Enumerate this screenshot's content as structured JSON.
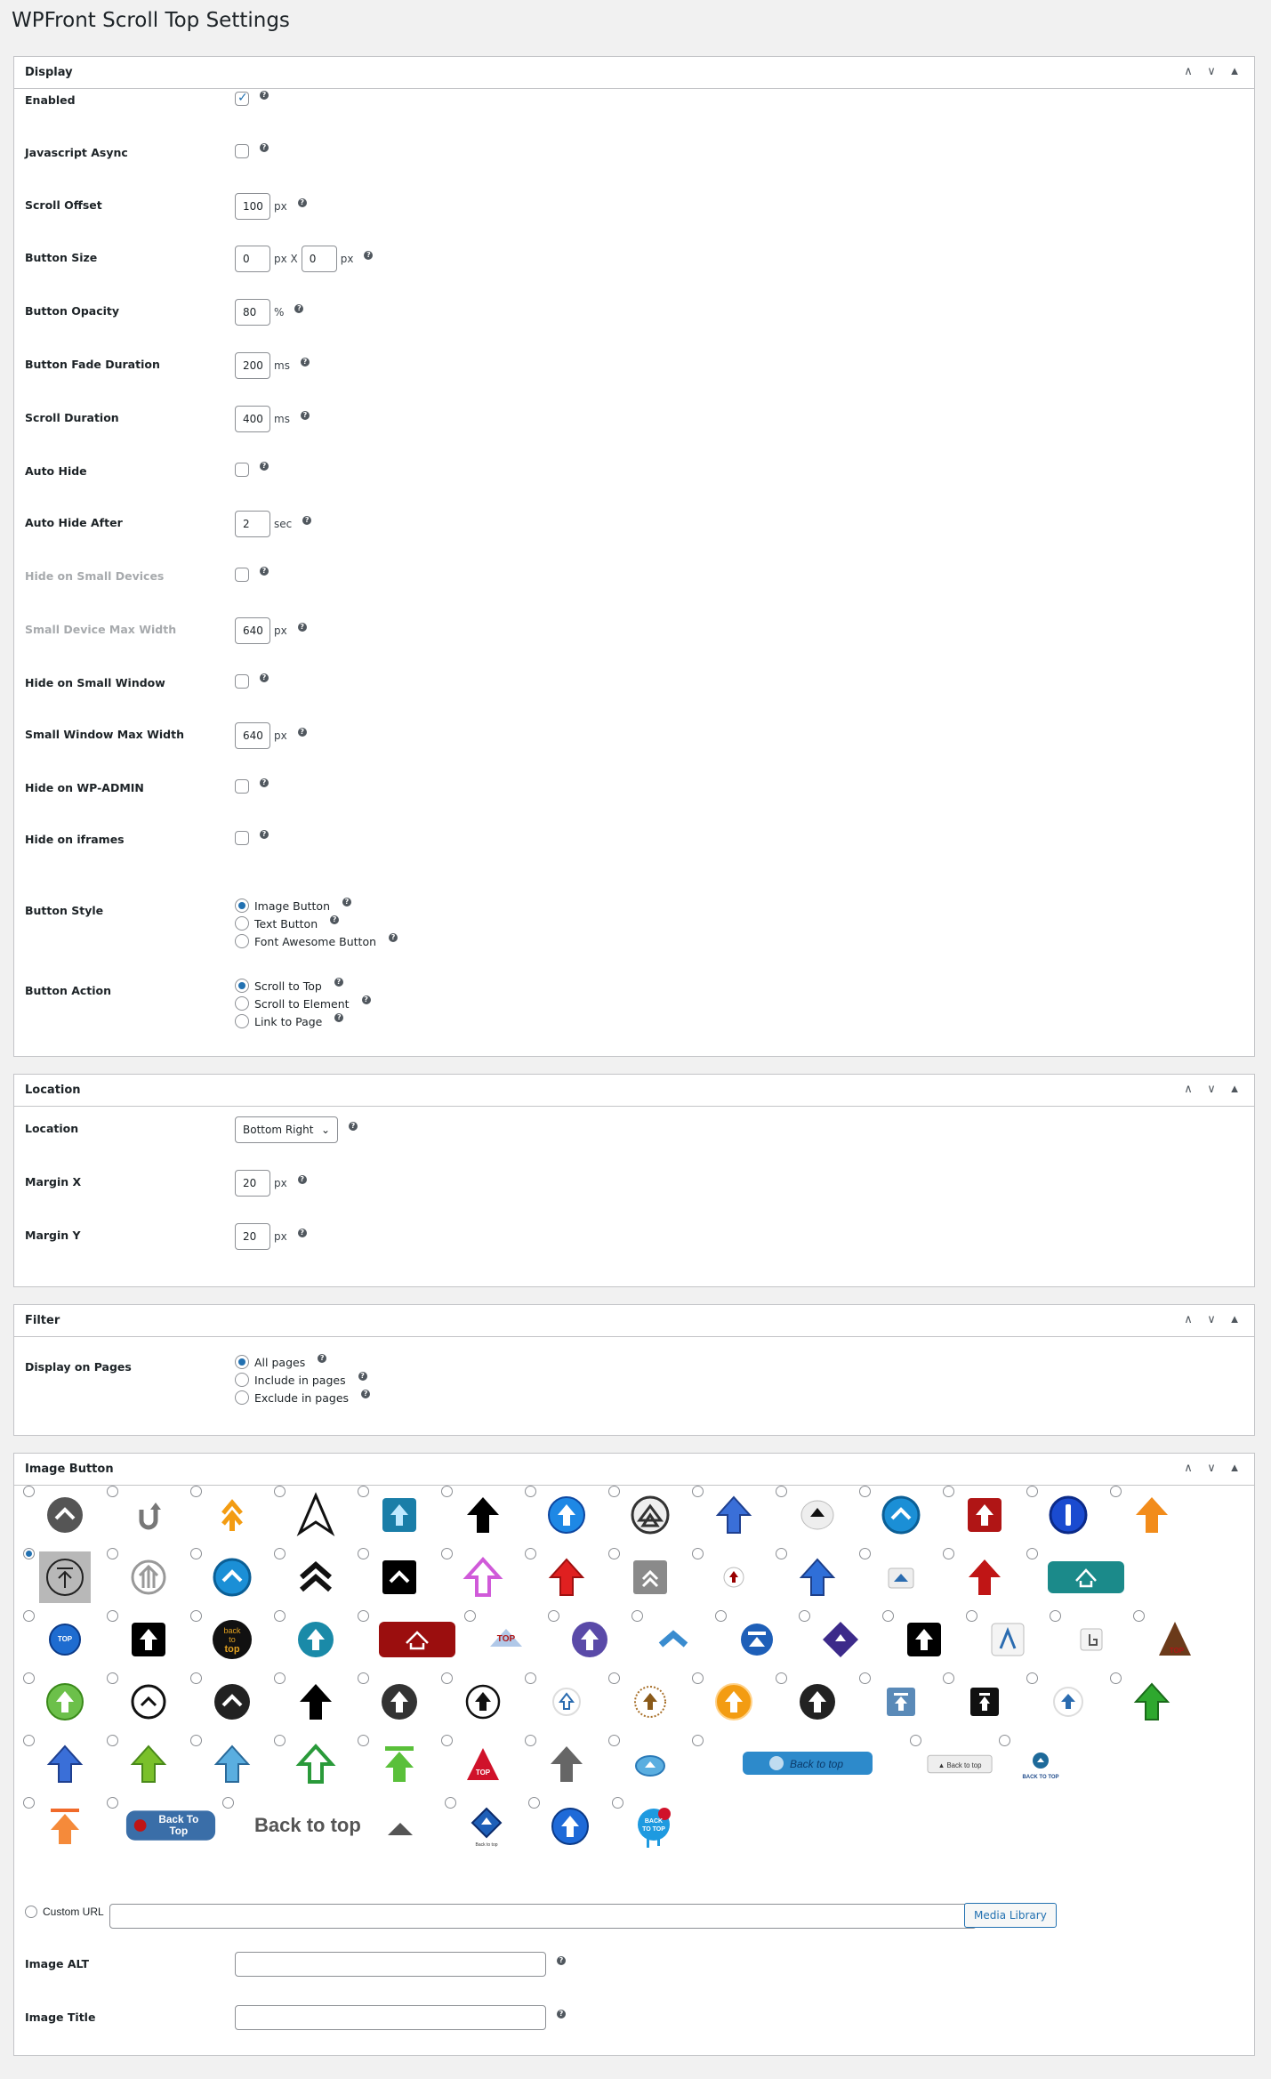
{
  "page_title": "WPFront Scroll Top Settings",
  "panel_controls": {
    "up": "∧",
    "down": "∨",
    "toggle": "▲"
  },
  "display": {
    "title": "Display",
    "rows": [
      {
        "label": "Enabled",
        "type": "checkbox",
        "checked": true
      },
      {
        "label": "Javascript Async",
        "type": "checkbox",
        "checked": false
      },
      {
        "label": "Scroll Offset",
        "type": "number",
        "value": "100",
        "unit": "px"
      },
      {
        "label": "Button Size",
        "type": "size",
        "value": "0",
        "unit": "px X",
        "value2": "0",
        "unit2": "px"
      },
      {
        "label": "Button Opacity",
        "type": "number",
        "value": "80",
        "unit": "%"
      },
      {
        "label": "Button Fade Duration",
        "type": "number",
        "value": "200",
        "unit": "ms"
      },
      {
        "label": "Scroll Duration",
        "type": "number",
        "value": "400",
        "unit": "ms"
      },
      {
        "label": "Auto Hide",
        "type": "checkbox",
        "checked": false
      },
      {
        "label": "Auto Hide After",
        "type": "number",
        "value": "2",
        "unit": "sec"
      },
      {
        "label": "Hide on Small Devices",
        "type": "checkbox",
        "checked": false,
        "dim": true
      },
      {
        "label": "Small Device Max Width",
        "type": "number",
        "value": "640",
        "unit": "px",
        "dim": true
      },
      {
        "label": "Hide on Small Window",
        "type": "checkbox",
        "checked": false
      },
      {
        "label": "Small Window Max Width",
        "type": "number",
        "value": "640",
        "unit": "px"
      },
      {
        "label": "Hide on WP-ADMIN",
        "type": "checkbox",
        "checked": false
      },
      {
        "label": "Hide on iframes",
        "type": "checkbox",
        "checked": false
      }
    ],
    "button_style": {
      "label": "Button Style",
      "options": [
        "Image Button",
        "Text Button",
        "Font Awesome Button"
      ],
      "selected": 0
    },
    "button_action": {
      "label": "Button Action",
      "options": [
        "Scroll to Top",
        "Scroll to Element",
        "Link to Page"
      ],
      "selected": 0
    }
  },
  "location": {
    "title": "Location",
    "location_label": "Location",
    "location_value": "Bottom Right",
    "margin_x_label": "Margin X",
    "margin_x": "20",
    "margin_y_label": "Margin Y",
    "margin_y": "20",
    "unit": "px"
  },
  "filter": {
    "title": "Filter",
    "label": "Display on Pages",
    "options": [
      "All pages",
      "Include in pages",
      "Exclude in pages"
    ],
    "selected": 0
  },
  "image_button": {
    "title": "Image Button",
    "selected_index": 14,
    "icons": [
      "gray-circle-chevron",
      "u-turn-arrow",
      "orange-double-chevron",
      "black-outline-arrow",
      "teal-square-arrow",
      "black-arrow",
      "blue-circle-arrow",
      "gray-triangle-circle",
      "blue-3d-arrow",
      "eject-button",
      "blue-chevron-circle",
      "red-square-arrow",
      "blue-exclamation-circle",
      "orange-arrow",
      "circle-bar-arrow",
      "gray-circle-arrows",
      "blue-chevron-circle",
      "black-double-chevron",
      "black-square-chevron",
      "pink-outline-arrow",
      "red-3d-arrow",
      "gray-square-chevron",
      "small-red-circle",
      "blue-arrow",
      "blue-triangle-button",
      "red-arrow",
      "teal-home-button",
      "blue-top-circle",
      "black-square-arrow",
      "black-back-to-top-circle",
      "teal-circle-arrow",
      "red-home-button",
      "top-badge",
      "purple-circle-arrow",
      "blue-chevron",
      "blue-bar-circle",
      "purple-diamond",
      "black-square-white-arrow",
      "blue-lambda-square",
      "hand-pointer",
      "brown-top-triangle",
      "green-circle-arrow",
      "black-outline-chevron-circle",
      "black-chevron-circle",
      "black-arrow-plain",
      "dark-circle-arrow",
      "outline-circle-arrow",
      "small-outline-arrow",
      "dotted-circle-arrow",
      "orange-circle-arrow",
      "black-circle-arrow",
      "blue-bar-square",
      "black-bar-square",
      "blue-up-circle",
      "green-3d-arrow",
      "blue-3d-arrow",
      "green-arrow",
      "light-blue-arrow",
      "green-outline-arrow",
      "green-bar-arrow",
      "red-top-triangle",
      "gray-arrow",
      "blue-oval-arrow",
      "back-to-top-bar",
      "back-to-top-small",
      "back-to-top-teal",
      "orange-bar-arrow",
      "back-to-top-button",
      "back-to-top-text",
      "blue-diamond-arrow",
      "blue-gloss-arrow",
      "back-to-top-splash"
    ],
    "custom_url_label": "Custom URL",
    "custom_url_value": "",
    "media_library_label": "Media Library",
    "alt_label": "Image ALT",
    "title_label": "Image Title",
    "help_mark": "?",
    "icon_texts": {
      "back_to_top_upper": "BACK TO TOP",
      "back_to_top": "Back to top",
      "back_to_top_title": "Back To Top",
      "back_to_top_words": "Back to top",
      "back_to_top_split": [
        "back",
        "to",
        "top"
      ],
      "top": "TOP",
      "top_upper": "TOP"
    }
  }
}
